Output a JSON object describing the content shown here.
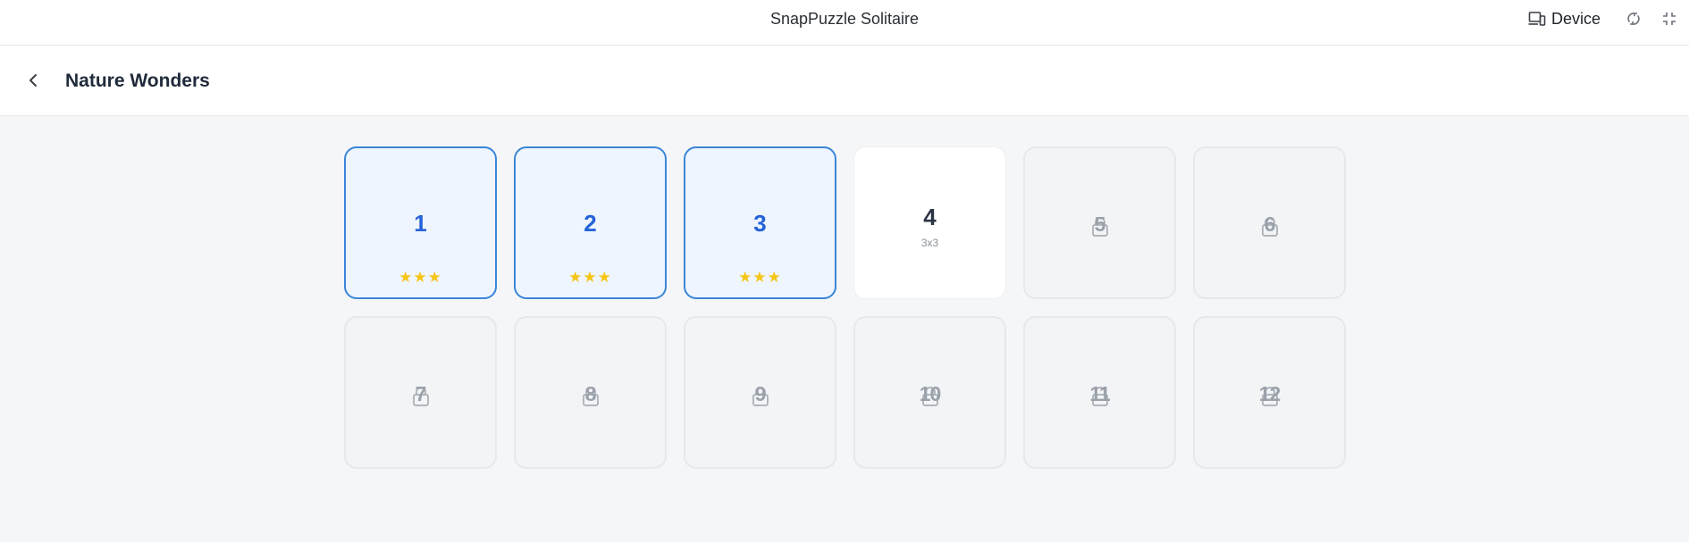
{
  "topbar": {
    "title": "SnapPuzzle Solitaire",
    "device_label": "Device",
    "icons": [
      "device-icon",
      "rotate-icon",
      "exit-fullscreen-icon"
    ]
  },
  "header": {
    "title": "Nature Wonders",
    "back_icon": "chevron-left-icon"
  },
  "colors": {
    "accent": "#2563d9",
    "completed_border": "#3a86d8",
    "completed_bg": "#eef5ff",
    "star": "#f5c518",
    "locked_text": "#9aa1aa"
  },
  "levels": [
    {
      "number": "1",
      "state": "completed",
      "stars": "★★★"
    },
    {
      "number": "2",
      "state": "completed",
      "stars": "★★★"
    },
    {
      "number": "3",
      "state": "completed",
      "stars": "★★★"
    },
    {
      "number": "4",
      "state": "current",
      "size": "3x3"
    },
    {
      "number": "5",
      "state": "locked"
    },
    {
      "number": "6",
      "state": "locked"
    },
    {
      "number": "7",
      "state": "locked"
    },
    {
      "number": "8",
      "state": "locked"
    },
    {
      "number": "9",
      "state": "locked"
    },
    {
      "number": "10",
      "state": "locked"
    },
    {
      "number": "11",
      "state": "locked"
    },
    {
      "number": "12",
      "state": "locked"
    }
  ]
}
